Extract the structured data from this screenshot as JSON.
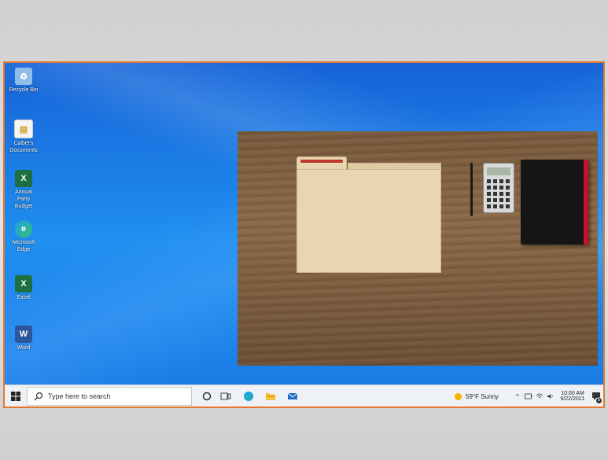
{
  "desktop": {
    "icons": [
      {
        "name": "Recycle Bin",
        "glyph": "recycle-bin-icon",
        "color": "#6fa8dc"
      },
      {
        "name": "Calbet's Documents",
        "glyph": "document-icon",
        "color": "#f1c40f"
      },
      {
        "name": "Annual Party Budget",
        "glyph": "excel-file-icon",
        "color": "#1d6f42"
      },
      {
        "name": "Microsoft Edge",
        "glyph": "edge-icon",
        "color": "#0f7bd6"
      },
      {
        "name": "Excel",
        "glyph": "excel-icon",
        "color": "#1d6f42"
      },
      {
        "name": "Word",
        "glyph": "word-icon",
        "color": "#2b579a"
      }
    ]
  },
  "taskbar": {
    "search_placeholder": "Type here to search",
    "weather": "59°F  Sunny",
    "time": "10:00 AM",
    "date": "9/22/2021",
    "notification_count": "5"
  },
  "colors": {
    "frame_border": "#e8772e",
    "desktop_blue": "#1f8ff0",
    "taskbar_bg": "#eef1f5"
  }
}
